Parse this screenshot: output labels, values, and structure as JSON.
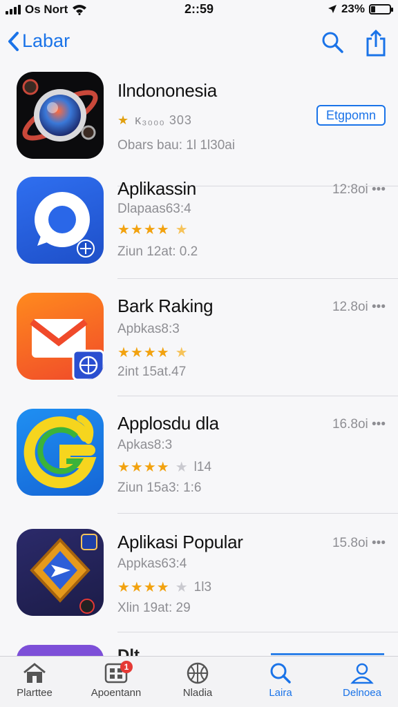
{
  "status": {
    "carrier": "Os Nort",
    "time": "2::59",
    "battery": "23%",
    "battery_level": 0.23
  },
  "nav": {
    "back_label": "Labar"
  },
  "apps": [
    {
      "name": "Ilndononesia",
      "rating_text": "ᴋ₃₀₀₀ 303",
      "size": "Obars bau: 1l 1l30ai",
      "button": "Etgpomn",
      "meta": "",
      "rating": 0
    },
    {
      "name": "Aplikassin",
      "sub": "Dlapaas63:4",
      "rating": 4.5,
      "count": "",
      "size": "Ziun 12at: 0.2",
      "meta": "12:8oi"
    },
    {
      "name": "Bark Raking",
      "sub": "Apbkas8:3",
      "rating": 4.5,
      "count": "",
      "size": "2int 15at.47",
      "meta": "12.8oi"
    },
    {
      "name": "Applosdu dla",
      "sub": "Apkas8:3",
      "rating": 4.5,
      "count": "l14",
      "size": "Ziun 15a3: 1:6",
      "meta": "16.8oi"
    },
    {
      "name": "Aplikasi Popular",
      "sub": "Appkas63:4",
      "rating": 4.5,
      "count": "1l3",
      "size": "Xlin 19at: 29",
      "meta": "15.8oi"
    }
  ],
  "peek": {
    "text": "Dlt..."
  },
  "tabs": [
    {
      "label": "Plarttee",
      "icon": "home-icon"
    },
    {
      "label": "Apoentann",
      "icon": "grid-icon",
      "badge": "1"
    },
    {
      "label": "Nladia",
      "icon": "basketball-icon"
    },
    {
      "label": "Laira",
      "icon": "search-icon"
    },
    {
      "label": "Delnoea",
      "icon": "person-icon"
    }
  ],
  "colors": {
    "accent": "#1a73e8",
    "star": "#f2a20f",
    "badge": "#e53935"
  }
}
